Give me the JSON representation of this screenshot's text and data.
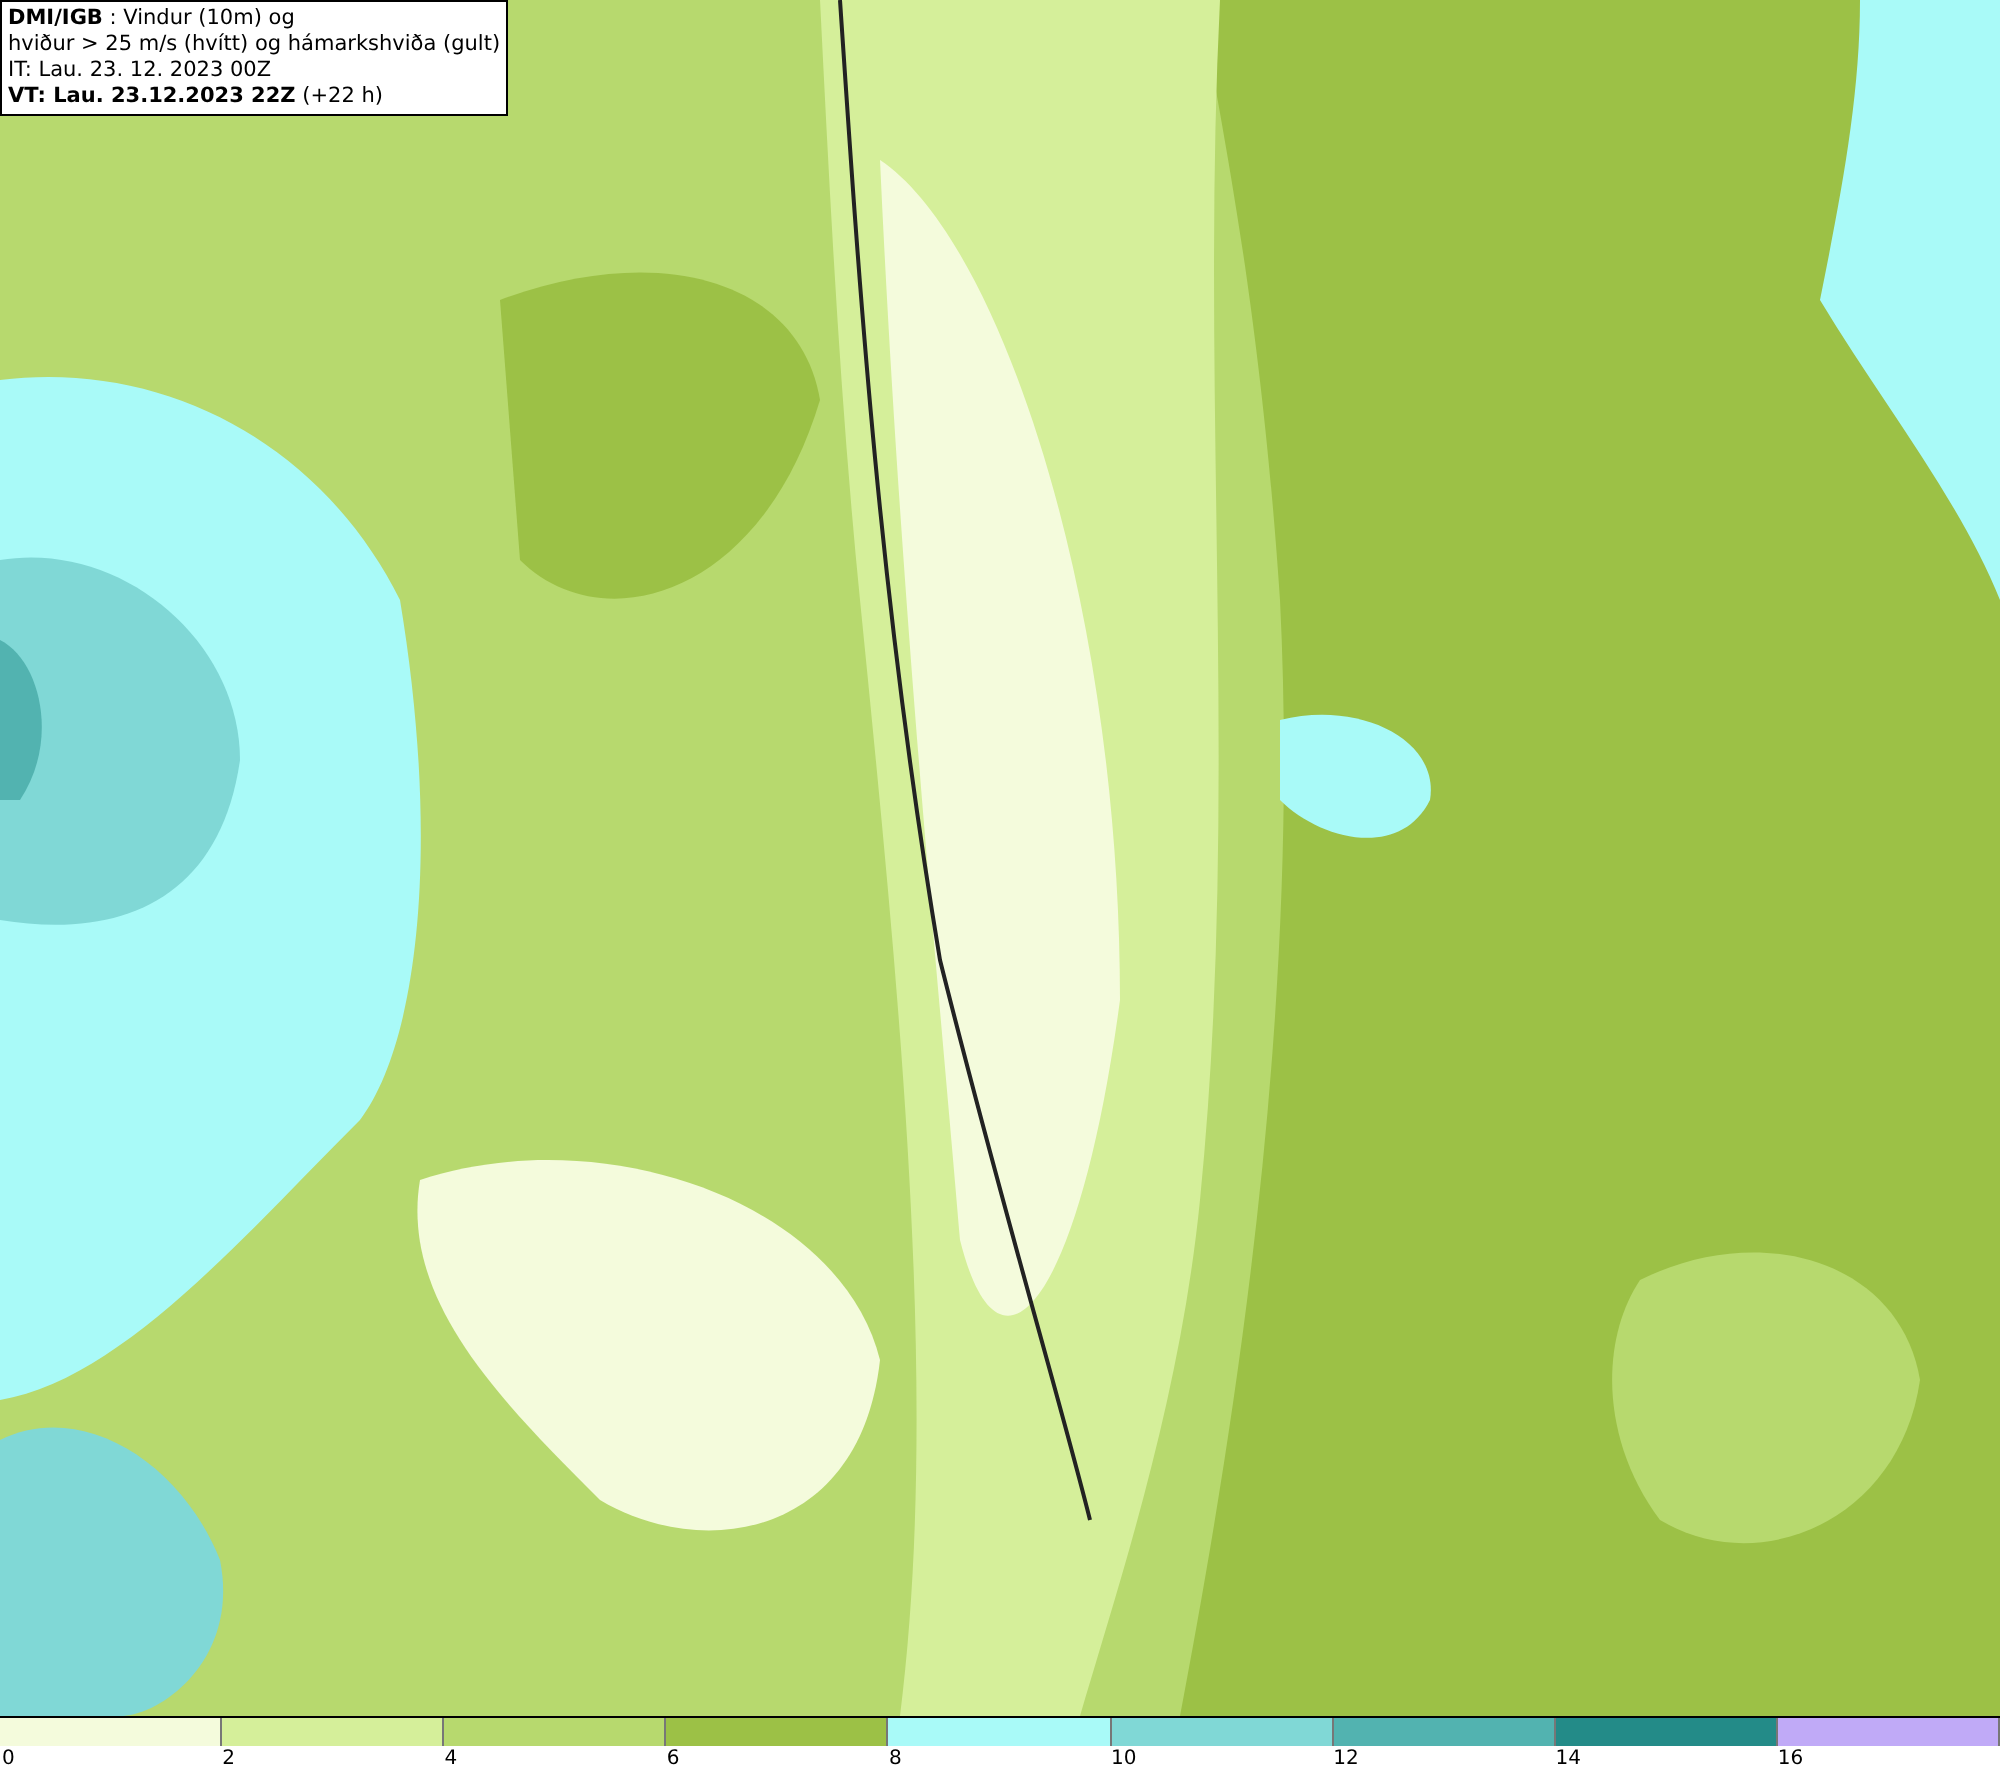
{
  "info_box": {
    "lines": [
      "**DMI/IGB** : Vindur (10m) og",
      "hviður > 25 m/s (hvítt) og hámarkshviða (gult)",
      "IT: Lau. 23. 12. 2023 00Z",
      "**VT: Lau. 23.12.2023 22Z** (+22 h)"
    ]
  },
  "legend": {
    "swatches": [
      {
        "color": "#f4fbdc"
      },
      {
        "color": "#d5ef9a"
      },
      {
        "color": "#b7d96e"
      },
      {
        "color": "#9cc146"
      },
      {
        "color": "#a9faf8"
      },
      {
        "color": "#80d8d6"
      },
      {
        "color": "#52b3b0"
      },
      {
        "color": "#238b88"
      },
      {
        "color": "#c0aaf7"
      }
    ],
    "ticks": [
      "0",
      "2",
      "4",
      "6",
      "8",
      "10",
      "12",
      "14",
      "16"
    ]
  }
}
